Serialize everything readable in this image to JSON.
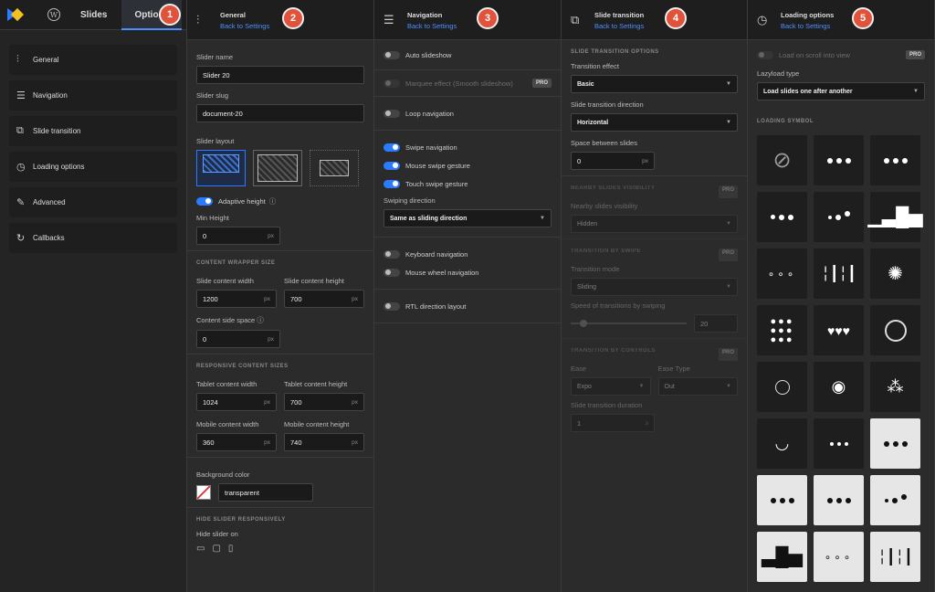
{
  "topnav": {
    "tab_slides": "Slides",
    "tab_options": "Options"
  },
  "sidebar": {
    "items": [
      {
        "label": "General",
        "icon": "sliders-icon"
      },
      {
        "label": "Navigation",
        "icon": "navigation-icon"
      },
      {
        "label": "Slide transition",
        "icon": "transition-icon"
      },
      {
        "label": "Loading options",
        "icon": "clock-icon"
      },
      {
        "label": "Advanced",
        "icon": "wrench-icon"
      },
      {
        "label": "Callbacks",
        "icon": "refresh-icon"
      }
    ]
  },
  "badges": [
    "1",
    "2",
    "3",
    "4",
    "5"
  ],
  "back": "Back to Settings",
  "general": {
    "title": "General",
    "slider_name_label": "Slider name",
    "slider_name": "Slider 20",
    "slug_label": "Slider slug",
    "slug": "document-20",
    "layout_label": "Slider layout",
    "adaptive": "Adaptive height",
    "min_height_label": "Min Height",
    "min_height": "0",
    "px": "px",
    "wrapper_caps": "CONTENT WRAPPER SIZE",
    "content_width_label": "Slide content width",
    "content_width": "1200",
    "content_height_label": "Slide content height",
    "content_height": "700",
    "side_space_label": "Content side space",
    "side_space": "0",
    "responsive_caps": "RESPONSIVE CONTENT SIZES",
    "tablet_w_label": "Tablet content width",
    "tablet_w": "1024",
    "tablet_h_label": "Tablet content height",
    "tablet_h": "700",
    "mobile_w_label": "Mobile content width",
    "mobile_w": "360",
    "mobile_h_label": "Mobile content height",
    "mobile_h": "740",
    "bg_label": "Background color",
    "bg": "transparent",
    "hide_caps": "HIDE SLIDER RESPONSIVELY",
    "hide_label": "Hide slider on"
  },
  "navigation": {
    "title": "Navigation",
    "auto": "Auto slideshow",
    "marquee": "Marquee effect (Smooth slideshow)",
    "pro": "PRO",
    "loop": "Loop navigation",
    "swipe": "Swipe navigation",
    "mouse_swipe": "Mouse swipe gesture",
    "touch_swipe": "Touch swipe gesture",
    "dir_label": "Swiping direction",
    "dir": "Same as sliding direction",
    "keyboard": "Keyboard navigation",
    "wheel": "Mouse wheel navigation",
    "rtl": "RTL direction layout"
  },
  "transition": {
    "title": "Slide transition",
    "caps": "SLIDE TRANSITION OPTIONS",
    "effect_label": "Transition effect",
    "effect": "Basic",
    "direction_label": "Slide transition direction",
    "direction": "Horizontal",
    "space_label": "Space between slides",
    "space": "0",
    "nearby_caps": "NEARBY SLIDES VISIBILITY",
    "nearby_label": "Nearby slides visibility",
    "nearby": "Hidden",
    "swipe_caps": "TRANSITION BY SWIPE",
    "mode_label": "Transition mode",
    "mode": "Sliding",
    "speed_label": "Speed of transitions by swiping",
    "speed": "20",
    "controls_caps": "TRANSITION BY CONTROLS",
    "ease_label": "Ease",
    "ease": "Expo",
    "ease_type_label": "Ease Type",
    "ease_type": "Out",
    "duration_label": "Slide transition duration",
    "duration": "1",
    "s": "s"
  },
  "loading": {
    "title": "Loading options",
    "on_scroll": "Load on scroll into view",
    "lazy_label": "Lazyload type",
    "lazy": "Load slides one after another",
    "symbol_caps": "LOADING SYMBOL"
  }
}
